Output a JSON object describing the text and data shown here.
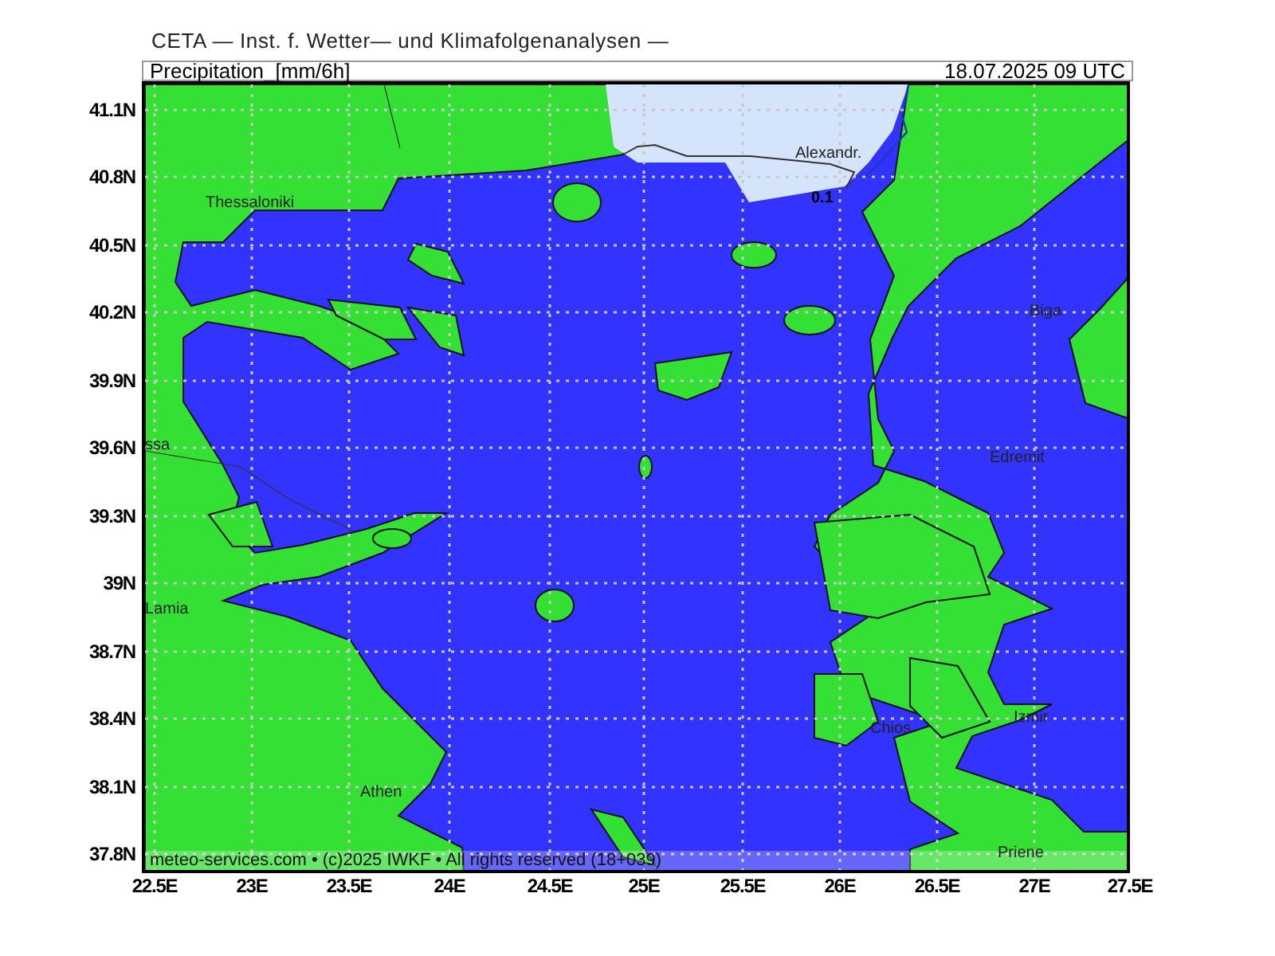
{
  "header": {
    "title": "CETA — Inst. f. Wetter— und Klimafolgenanalysen —"
  },
  "map": {
    "title": "Precipitation_[mm/6h]",
    "valid_time": "18.07.2025 09 UTC",
    "lat_labels": [
      "41.1N",
      "40.8N",
      "40.5N",
      "40.2N",
      "39.9N",
      "39.6N",
      "39.3N",
      "39N",
      "38.7N",
      "38.4N",
      "38.1N",
      "37.8N"
    ],
    "lon_labels": [
      "22.5E",
      "23E",
      "23.5E",
      "24E",
      "24.5E",
      "25E",
      "25.5E",
      "26E",
      "26.5E",
      "27E",
      "27.5E"
    ],
    "place_labels": [
      {
        "kind": "city",
        "text": "Alexandr."
      },
      {
        "kind": "city",
        "text": "Thessaloniki"
      },
      {
        "kind": "city",
        "text": "Biga"
      },
      {
        "kind": "city",
        "text": "ssa"
      },
      {
        "kind": "city",
        "text": "Edremit"
      },
      {
        "kind": "city",
        "text": "Lamia"
      },
      {
        "kind": "city",
        "text": "Chios"
      },
      {
        "kind": "city",
        "text": "Izmir"
      },
      {
        "kind": "city",
        "text": "Athen"
      },
      {
        "kind": "city",
        "text": "Priene"
      },
      {
        "kind": "contour",
        "text": "0.1"
      }
    ],
    "footer": "meteo-services.com • (c)2025 IWKF • All rights reserved (18+039)"
  }
}
